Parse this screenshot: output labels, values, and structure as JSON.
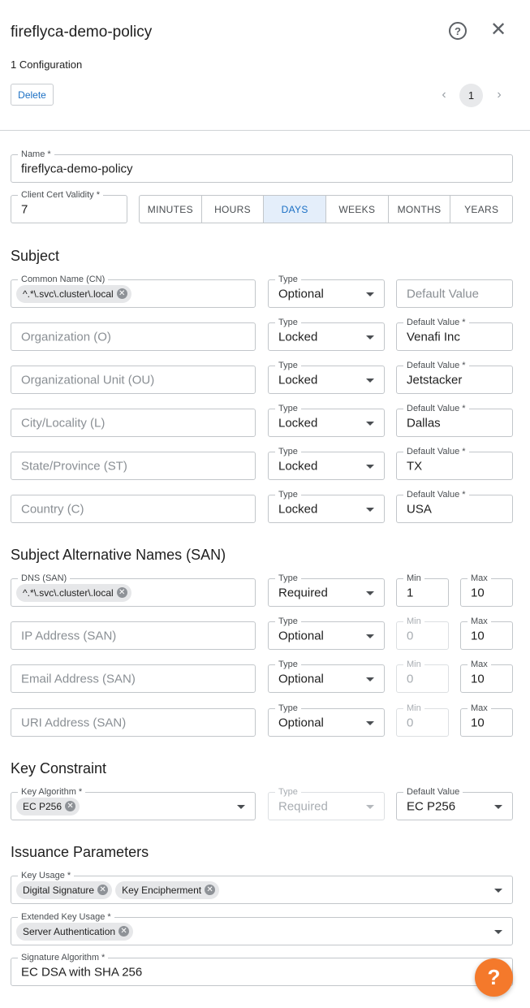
{
  "header": {
    "title": "fireflyca-demo-policy",
    "help_icon": "help-circle-icon",
    "help_glyph": "?",
    "close_glyph": "✕",
    "config_count": "1 Configuration",
    "delete_label": "Delete",
    "pagination": {
      "prev": "‹",
      "current": "1",
      "next": "›"
    }
  },
  "name_field": {
    "label": "Name *",
    "value": "fireflyca-demo-policy"
  },
  "validity": {
    "label": "Client Cert Validity *",
    "value": "7",
    "units": [
      "MINUTES",
      "HOURS",
      "DAYS",
      "WEEKS",
      "MONTHS",
      "YEARS"
    ],
    "selected_unit": "DAYS"
  },
  "subject": {
    "heading": "Subject",
    "rows": [
      {
        "name_label": "Common Name (CN)",
        "chip": "^.*\\.svc\\.cluster\\.local",
        "type_label": "Type",
        "type": "Optional",
        "default_label": "",
        "default_placeholder": "Default Value",
        "default_value": ""
      },
      {
        "name_placeholder": "Organization (O)",
        "type_label": "Type",
        "type": "Locked",
        "default_label": "Default Value *",
        "default_value": "Venafi Inc"
      },
      {
        "name_placeholder": "Organizational Unit (OU)",
        "type_label": "Type",
        "type": "Locked",
        "default_label": "Default Value *",
        "default_value": "Jetstacker"
      },
      {
        "name_placeholder": "City/Locality (L)",
        "type_label": "Type",
        "type": "Locked",
        "default_label": "Default Value *",
        "default_value": "Dallas"
      },
      {
        "name_placeholder": "State/Province (ST)",
        "type_label": "Type",
        "type": "Locked",
        "default_label": "Default Value *",
        "default_value": "TX"
      },
      {
        "name_placeholder": "Country (C)",
        "type_label": "Type",
        "type": "Locked",
        "default_label": "Default Value *",
        "default_value": "USA"
      }
    ]
  },
  "san": {
    "heading": "Subject Alternative Names (SAN)",
    "rows": [
      {
        "name_label": "DNS (SAN)",
        "chip": "^.*\\.svc\\.cluster\\.local",
        "type_label": "Type",
        "type": "Required",
        "min_label": "Min",
        "min": "1",
        "min_placeholder": "",
        "max_label": "Max",
        "max": "10"
      },
      {
        "name_placeholder": "IP Address (SAN)",
        "type_label": "Type",
        "type": "Optional",
        "min_label": "Min",
        "min": "",
        "min_placeholder": "0",
        "max_label": "Max",
        "max": "10"
      },
      {
        "name_placeholder": "Email Address (SAN)",
        "type_label": "Type",
        "type": "Optional",
        "min_label": "Min",
        "min": "",
        "min_placeholder": "0",
        "max_label": "Max",
        "max": "10"
      },
      {
        "name_placeholder": "URI Address (SAN)",
        "type_label": "Type",
        "type": "Optional",
        "min_label": "Min",
        "min": "",
        "min_placeholder": "0",
        "max_label": "Max",
        "max": "10"
      }
    ]
  },
  "key_constraint": {
    "heading": "Key Constraint",
    "algorithm_label": "Key Algorithm *",
    "algorithm_chip": "EC P256",
    "type_label": "Type",
    "type": "Required",
    "default_label": "Default Value",
    "default_value": "EC P256"
  },
  "issuance": {
    "heading": "Issuance Parameters",
    "key_usage_label": "Key Usage *",
    "key_usage_chips": [
      "Digital Signature",
      "Key Encipherment"
    ],
    "ext_key_usage_label": "Extended Key Usage *",
    "ext_key_usage_chips": [
      "Server Authentication"
    ],
    "sig_alg_label": "Signature Algorithm *",
    "sig_alg_value": "EC DSA with SHA 256"
  },
  "fab_glyph": "?",
  "colors": {
    "accent": "#1a6fc4",
    "fab": "#f4792b",
    "segment_active_bg": "#e4eefa"
  }
}
